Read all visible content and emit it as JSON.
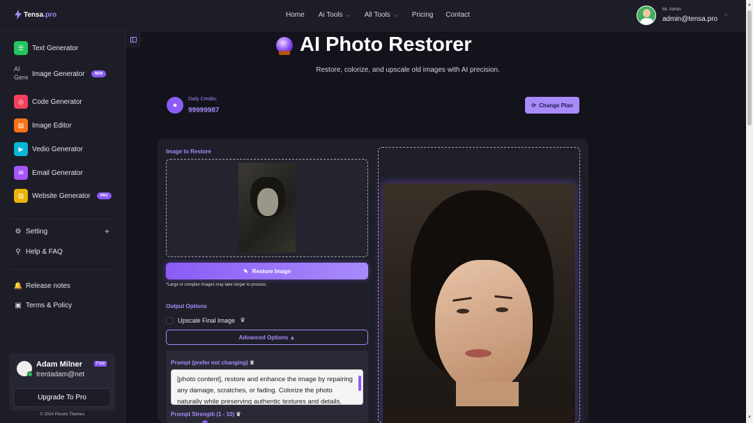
{
  "brand": {
    "name": "Tensa",
    "tld": ".pro",
    "accent": "#a78bfa"
  },
  "nav": {
    "items": [
      {
        "label": "Home",
        "dropdown": false
      },
      {
        "label": "Ai Tools",
        "dropdown": true
      },
      {
        "label": "All Tools",
        "dropdown": true
      },
      {
        "label": "Pricing",
        "dropdown": false
      },
      {
        "label": "Contact",
        "dropdown": false
      }
    ]
  },
  "user": {
    "role": "Mr. Admin",
    "email": "admin@tensa.pro"
  },
  "sidebar": {
    "items": [
      {
        "label": "Text Generator",
        "icon": "text-icon",
        "color": "#22c55e",
        "tag": ""
      },
      {
        "label": "Image Generator",
        "icon": "broken-image",
        "alt": "AI Gene",
        "color": "",
        "tag": "NEW"
      },
      {
        "label": "Code Generator",
        "icon": "code-icon",
        "color": "#f43f5e",
        "tag": ""
      },
      {
        "label": "Image Editor",
        "icon": "image-edit-icon",
        "color": "#f97316",
        "tag": ""
      },
      {
        "label": "Vedio Generator",
        "icon": "video-icon",
        "color": "#06b6d4",
        "tag": ""
      },
      {
        "label": "Email Generator",
        "icon": "email-icon",
        "color": "#a855f7",
        "tag": ""
      },
      {
        "label": "Website Generator",
        "icon": "website-icon",
        "color": "#eab308",
        "tag": "PRO"
      }
    ],
    "misc": [
      {
        "label": "Setting",
        "icon": "gear-icon"
      },
      {
        "label": "Help & FAQ",
        "icon": "help-icon"
      }
    ],
    "footer_links": [
      {
        "label": "Release notes",
        "icon": "bell-icon"
      },
      {
        "label": "Terms & Policy",
        "icon": "briefcase-icon"
      }
    ],
    "card": {
      "name": "Adam Milner",
      "email": "trentadam@net",
      "badge": "Free",
      "upgrade": "Upgrade To Pro"
    },
    "copyright": "© 2024 Pixcels Themes."
  },
  "page": {
    "title": "AI Photo Restorer",
    "subtitle": "Restore, colorize, and upscale old images with AI precision."
  },
  "credits": {
    "label": "Daily Credits:",
    "value": "99999987"
  },
  "change_plan": "Change Plan",
  "form": {
    "image_label": "Image to Restore",
    "restore_button": "Restore Image",
    "note": "*Large or complex images may take longer to process.",
    "output_options": "Output Options",
    "upscale_label": "Upscale Final Image",
    "upscale_checked": false,
    "advanced": "Advanced Options ▲",
    "prompt_label": "Prompt (prefer not changing)",
    "prompt_text": "[photo content], restore and enhance the image by repairing any damage, scratches, or fading. Colorize the photo naturally while preserving authentic textures and details, maintaining a",
    "strength_label": "Prompt Strength (1 - 10)"
  }
}
